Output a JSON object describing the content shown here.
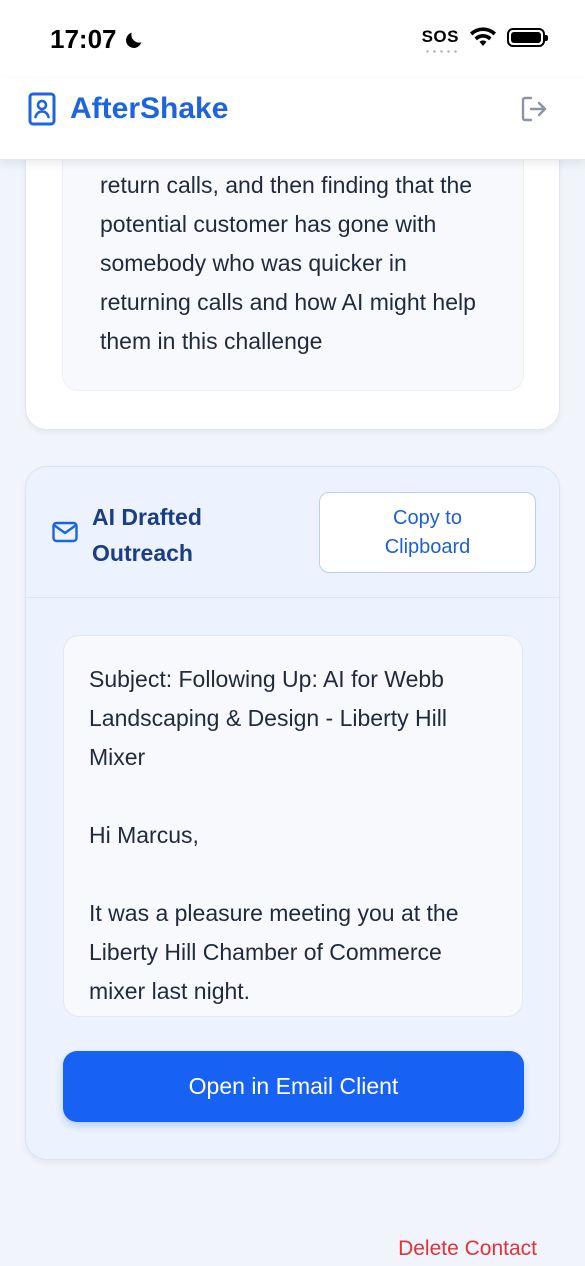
{
  "status_bar": {
    "time": "17:07",
    "sos_label": "SOS",
    "icons": [
      "moon-icon",
      "wifi-icon",
      "battery-icon"
    ]
  },
  "header": {
    "app_name": "AfterShake",
    "brand_icon": "contact-book-icon",
    "logout_icon": "logout-icon",
    "brand_color": "#1d64e0"
  },
  "notes": {
    "text": "return calls, and then finding that the potential customer has gone with somebody who was quicker in returning calls and how AI might help them in this challenge"
  },
  "outreach": {
    "title": "AI Drafted Outreach",
    "icon": "mail-icon",
    "copy_button_label": "Copy to Clipboard",
    "email_text": "Subject: Following Up: AI for Webb Landscaping & Design - Liberty Hill Mixer\n\nHi Marcus,\n\nIt was a pleasure meeting you at the Liberty Hill Chamber of Commerce mixer last night.",
    "open_button_label": "Open in Email Client",
    "accent_color": "#1762f2"
  },
  "delete_contact_label": "Delete Contact",
  "danger_color": "#e0343a"
}
